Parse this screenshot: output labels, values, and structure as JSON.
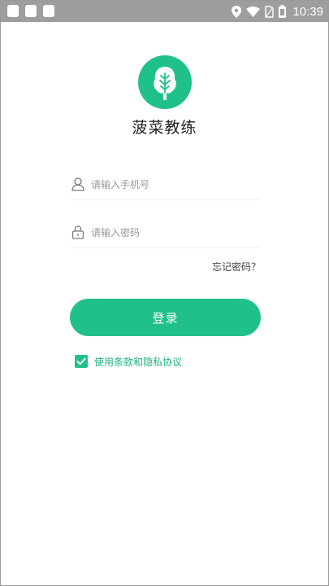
{
  "status_bar": {
    "time": "10:39",
    "icons": [
      "notification-icon",
      "notification-icon",
      "notification-icon",
      "location-icon",
      "wifi-icon",
      "no-sim-icon",
      "battery-icon"
    ]
  },
  "app": {
    "name": "菠菜教练",
    "logo_icon": "leaf-icon"
  },
  "login_form": {
    "phone_placeholder": "请输入手机号",
    "phone_value": "",
    "phone_icon": "user-icon",
    "password_placeholder": "请输入密码",
    "password_value": "",
    "password_icon": "lock-icon",
    "forgot_password": "忘记密码？",
    "login_button": "登录",
    "agreement_checked": true,
    "agreement_label": "使用条款和隐私协议"
  },
  "colors": {
    "accent": "#20c188",
    "status_bar": "#9e9e9e",
    "background": "#ffffff"
  }
}
